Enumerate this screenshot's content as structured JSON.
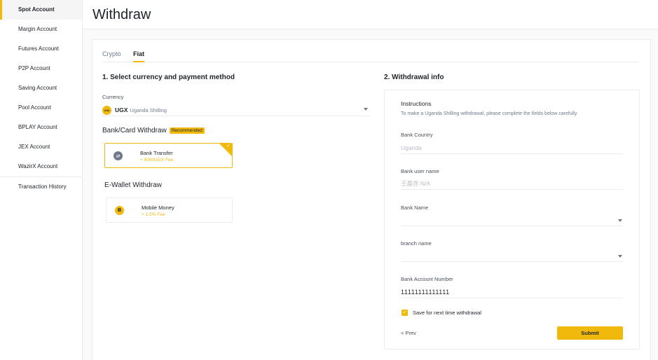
{
  "sidebar": {
    "items": [
      {
        "label": "Spot Account"
      },
      {
        "label": "Margin Account"
      },
      {
        "label": "Futures Account"
      },
      {
        "label": "P2P Account"
      },
      {
        "label": "Saving Account"
      },
      {
        "label": "Pool Account"
      },
      {
        "label": "BPLAY Account"
      },
      {
        "label": "JEX Account"
      },
      {
        "label": "WazirX Account"
      },
      {
        "label": "Transaction History"
      }
    ]
  },
  "page": {
    "title": "Withdraw"
  },
  "tabs": [
    {
      "label": "Crypto"
    },
    {
      "label": "Fiat"
    }
  ],
  "section1": {
    "title": "1. Select currency and payment method",
    "currency_label": "Currency",
    "currency": {
      "icon_text": "USh",
      "code": "UGX",
      "name": "Uganda Shilling"
    },
    "bank_card_title": "Bank/Card Withdraw",
    "recommended_badge": "Recommended",
    "bank_transfer": {
      "name": "Bank Transfer",
      "fee": "+ 8000UGX Fee"
    },
    "ewallet_title": "E-Wallet Withdraw",
    "mobile_money": {
      "name": "Mobile Money",
      "fee": "+ 1.5% Fee"
    }
  },
  "section2": {
    "title": "2. Withdrawal info",
    "instructions_title": "Instructions",
    "instructions_text": "To make a Uganda Shilling withdrawal, please complete the fields below carefully",
    "fields": {
      "bank_country": {
        "label": "Bank Country",
        "placeholder": "Uganda"
      },
      "bank_user_name": {
        "label": "Bank user name",
        "placeholder": "王晨亦 N/A"
      },
      "bank_name": {
        "label": "Bank Name",
        "value": ""
      },
      "branch_name": {
        "label": "branch name",
        "value": ""
      },
      "bank_account_number": {
        "label": "Bank Account Number",
        "value": "11111111111111"
      }
    },
    "save_checkbox_label": "Save for next time withdrawal",
    "save_checked": true,
    "prev_label": "< Prev",
    "submit_label": "Submit"
  },
  "colors": {
    "accent": "#f0b90b",
    "text": "#1e2329",
    "border": "#eaecef"
  }
}
